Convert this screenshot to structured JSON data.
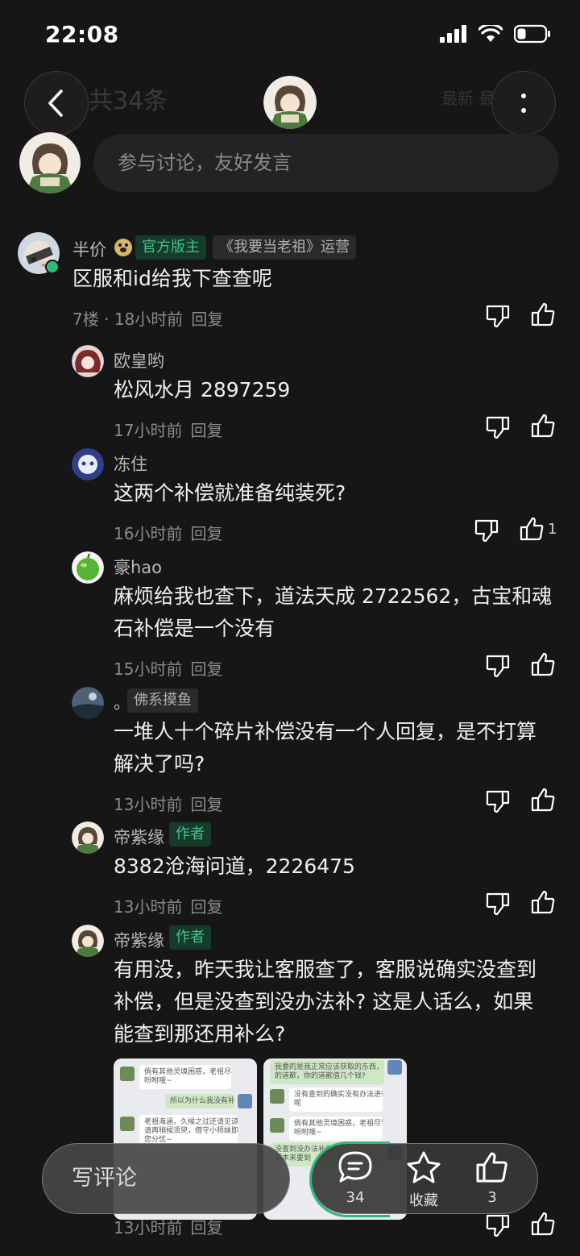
{
  "status": {
    "time": "22:08"
  },
  "header": {
    "ghost_title": "共34条",
    "ghost_right": "最新 最热"
  },
  "input": {
    "placeholder": "参与讨论，友好发言"
  },
  "main_comment": {
    "author": "半价",
    "badge_official": "官方版主",
    "badge_role": "《我要当老祖》运营",
    "text": "区服和id给我下查查呢",
    "floor": "7楼",
    "time": "18小时前",
    "reply": "回复"
  },
  "replies": [
    {
      "author": "欧皇哟",
      "lines": [
        "松风水月 2897259"
      ],
      "time": "17小时前",
      "reply": "回复",
      "likes": ""
    },
    {
      "author": "冻住",
      "lines": [
        "这两个补偿就准备纯装死?"
      ],
      "time": "16小时前",
      "reply": "回复",
      "likes": "1"
    },
    {
      "author": "豪hao",
      "lines": [
        "麻烦给我也查下，道法天成 2722562，古宝和魂",
        "石补偿是一个没有"
      ],
      "time": "15小时前",
      "reply": "回复",
      "likes": ""
    },
    {
      "author": "。",
      "tag": "佛系摸鱼",
      "lines": [
        "一堆人十个碎片补偿没有一个人回复，是不打算",
        "解决了吗?"
      ],
      "time": "13小时前",
      "reply": "回复",
      "likes": ""
    },
    {
      "author": "帝紫缘",
      "tag": "作者",
      "lines": [
        "8382沧海问道，2226475"
      ],
      "time": "13小时前",
      "reply": "回复",
      "likes": ""
    },
    {
      "author": "帝紫缘",
      "tag": "作者",
      "lines": [
        "有用没，昨天我让客服查了，客服说确实没查到",
        "补偿，但是没查到没办法补? 这是人话么，如果",
        "能查到那还用补么?"
      ],
      "time": "13小时前",
      "reply": "回复",
      "likes": ""
    }
  ],
  "screenshots": [
    {
      "b1": "倘有其他灵境困惑，老祖尽管开口",
      "b1b": "吩咐哦~",
      "b2": "所以为什么我没有补偿?",
      "b3": "老祖海涵，久候之过还请见谅! 烦",
      "b3b": "请再稍候须臾，借守小师妹即刻为",
      "b3c": "您分忧~"
    },
    {
      "b1": "我要的是我正常应该获取的东西，不是你",
      "b1b": "的道歉，你的道歉值几个钱?",
      "b2": "没有查到的确实没有办法进行补偿",
      "b2b": "呢",
      "b3": "倘有其他灵境困惑，老祖尽管开口",
      "b3b": "吩咐哦~",
      "b4": "没查到没办法补偿?",
      "b4b": "那本来要到"
    }
  ],
  "bottom": {
    "comment_label": "写评论",
    "comments_count": "34",
    "favorite_label": "收藏",
    "likes_count": "3"
  }
}
